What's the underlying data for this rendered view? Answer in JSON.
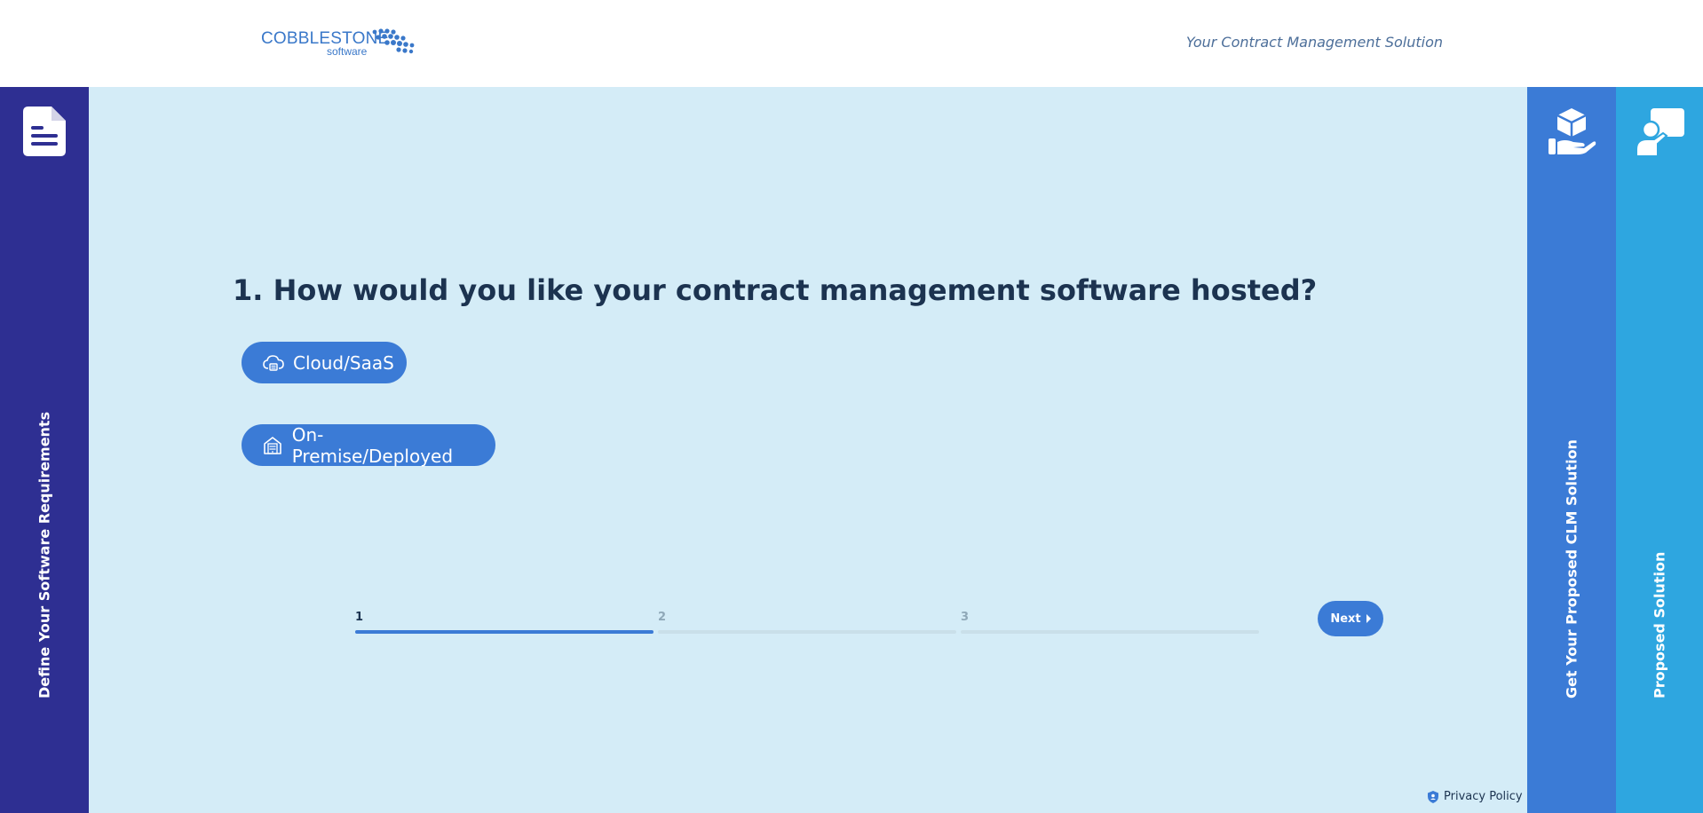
{
  "header": {
    "logo_word": "COBBLESTONE",
    "logo_sub": "software",
    "tagline": "Your Contract Management Solution"
  },
  "rails": {
    "left_label": "Define Your Software Requirements",
    "right1_label": "Get Your Proposed CLM Solution",
    "right2_label": "Proposed Solution",
    "left_icon": "document-icon",
    "right1_icon": "hand-box-icon",
    "right2_icon": "presenter-icon"
  },
  "question": {
    "text": "1. How would you like your contract management software hosted?",
    "options": [
      {
        "label": "Cloud/SaaS",
        "icon": "cloud-icon"
      },
      {
        "label": "On-Premise/Deployed",
        "icon": "building-icon"
      }
    ]
  },
  "progress": {
    "steps": [
      "1",
      "2",
      "3"
    ],
    "current_step": 1,
    "step_fill": [
      1.0,
      0.0,
      0.0
    ]
  },
  "next_label": "Next",
  "privacy_label": "Privacy Policy",
  "colors": {
    "background": "#d4ecf7",
    "rail_left": "#2e2f92",
    "rail_right1": "#3b7bd6",
    "rail_right2": "#2ea6e0",
    "accent": "#3b7bd6",
    "heading": "#1c3350"
  }
}
